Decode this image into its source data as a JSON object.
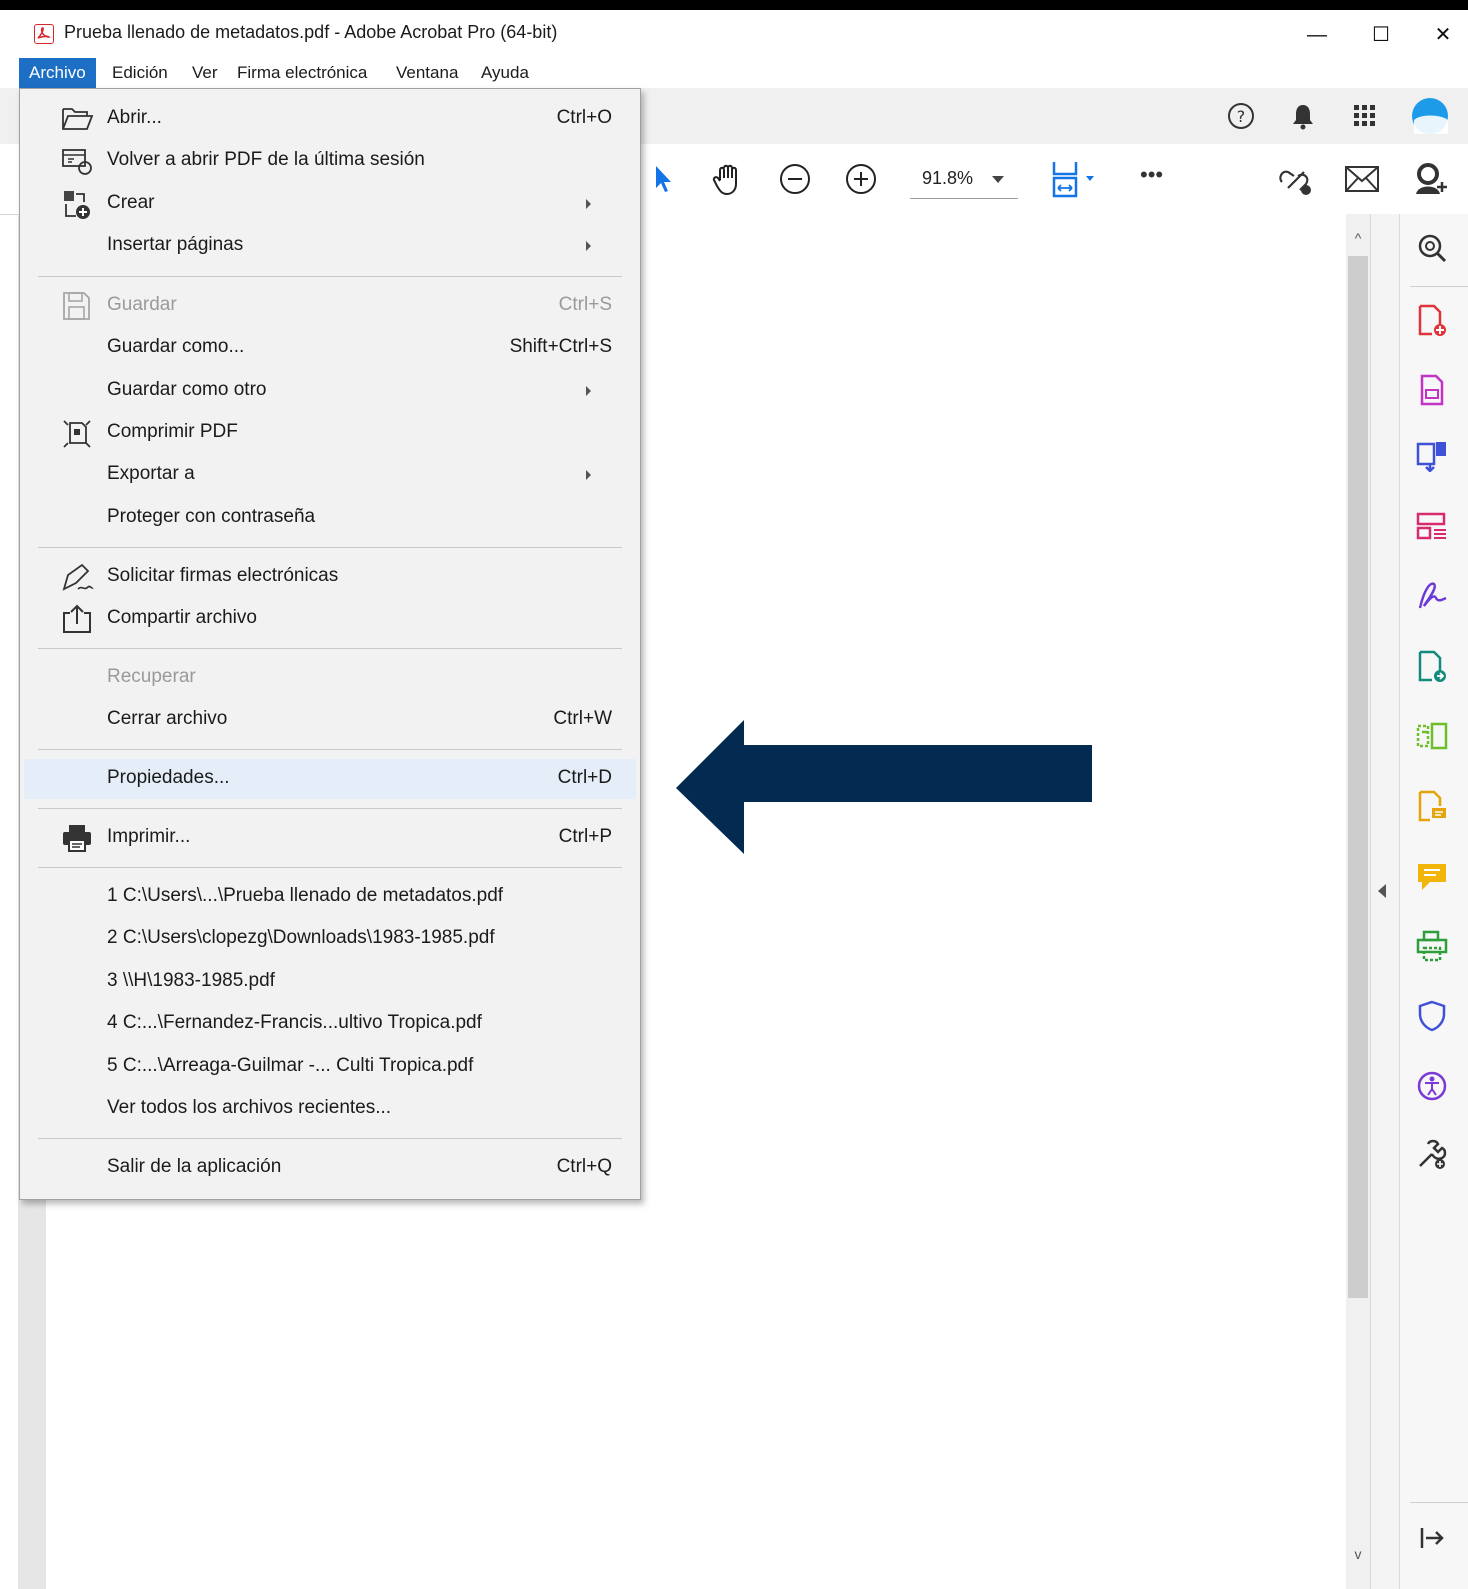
{
  "window": {
    "title": "Prueba llenado de metadatos.pdf - Adobe Acrobat Pro (64-bit)",
    "controls": {
      "minimize": "—",
      "maximize": "☐",
      "close": "✕"
    }
  },
  "menubar": {
    "items": [
      {
        "label": "Archivo",
        "active": true
      },
      {
        "label": "Edición"
      },
      {
        "label": "Ver"
      },
      {
        "label": "Firma electrónica"
      },
      {
        "label": "Ventana"
      },
      {
        "label": "Ayuda"
      }
    ]
  },
  "toolbar": {
    "zoom": "91.8%",
    "more": "•••",
    "icons": [
      "help-icon",
      "bell-icon",
      "apps-grid-icon",
      "account-icon",
      "select-arrow-icon",
      "hand-icon",
      "zoom-out-icon",
      "zoom-in-icon",
      "fit-page-icon",
      "link-icon",
      "mail-icon",
      "add-user-icon"
    ]
  },
  "file_menu": {
    "items": [
      {
        "id": "abrir",
        "label": "Abrir...",
        "shortcut": "Ctrl+O",
        "icon": "folder-open-icon"
      },
      {
        "id": "volver",
        "label": "Volver a abrir PDF de la última sesión",
        "shortcut": "",
        "icon": "reopen-session-icon"
      },
      {
        "id": "crear",
        "label": "Crear",
        "shortcut": "",
        "icon": "create-pdf-icon",
        "submenu": true
      },
      {
        "id": "insertar",
        "label": "Insertar páginas",
        "shortcut": "",
        "submenu": true
      },
      {
        "id": "guardar",
        "label": "Guardar",
        "shortcut": "Ctrl+S",
        "icon": "save-icon",
        "disabled": true
      },
      {
        "id": "guardar-como",
        "label": "Guardar como...",
        "shortcut": "Shift+Ctrl+S"
      },
      {
        "id": "guardar-como-otro",
        "label": "Guardar como otro",
        "shortcut": "",
        "submenu": true
      },
      {
        "id": "comprimir",
        "label": "Comprimir PDF",
        "shortcut": "",
        "icon": "compress-icon"
      },
      {
        "id": "exportar",
        "label": "Exportar a",
        "shortcut": "",
        "submenu": true
      },
      {
        "id": "proteger",
        "label": "Proteger con contraseña",
        "shortcut": ""
      },
      {
        "id": "solicitar",
        "label": "Solicitar firmas electrónicas",
        "shortcut": "",
        "icon": "sign-request-icon"
      },
      {
        "id": "compartir",
        "label": "Compartir archivo",
        "shortcut": "",
        "icon": "share-icon"
      },
      {
        "id": "recuperar",
        "label": "Recuperar",
        "shortcut": "",
        "disabled": true
      },
      {
        "id": "cerrar",
        "label": "Cerrar archivo",
        "shortcut": "Ctrl+W"
      },
      {
        "id": "propiedades",
        "label": "Propiedades...",
        "shortcut": "Ctrl+D",
        "highlight": true
      },
      {
        "id": "imprimir",
        "label": "Imprimir...",
        "shortcut": "Ctrl+P",
        "icon": "printer-icon"
      },
      {
        "id": "recent-1",
        "label": "1 C:\\Users\\...\\Prueba llenado de metadatos.pdf",
        "shortcut": ""
      },
      {
        "id": "recent-2",
        "label": "2 C:\\Users\\clopezg\\Downloads\\1983-1985.pdf",
        "shortcut": ""
      },
      {
        "id": "recent-3",
        "label": "3 \\\\H\\1983-1985.pdf",
        "shortcut": ""
      },
      {
        "id": "recent-4",
        "label": "4 C:...\\Fernandez-Francis...ultivo Tropica.pdf",
        "shortcut": ""
      },
      {
        "id": "recent-5",
        "label": "5 C:...\\Arreaga-Guilmar -... Culti Tropica.pdf",
        "shortcut": ""
      },
      {
        "id": "ver-todos",
        "label": "Ver todos los archivos recientes...",
        "shortcut": ""
      },
      {
        "id": "salir",
        "label": "Salir de la aplicación",
        "shortcut": "Ctrl+Q"
      }
    ]
  },
  "annotation": {
    "arrow_color": "#032b52",
    "points_to": "propiedades"
  },
  "colors": {
    "menu_active": "#1c6fc4",
    "highlight_row": "#e5eef8"
  },
  "right_tools": [
    "search-enhance-icon",
    "create-pdf-tool-icon",
    "edit-pdf-icon",
    "export-pdf-icon",
    "organize-pages-icon",
    "fill-sign-icon",
    "combine-files-icon",
    "scan-ocr-icon",
    "comment-doc-icon",
    "comment-icon",
    "print-production-icon",
    "protect-icon",
    "accessibility-icon",
    "more-tools-icon",
    "expand-pane-icon"
  ]
}
